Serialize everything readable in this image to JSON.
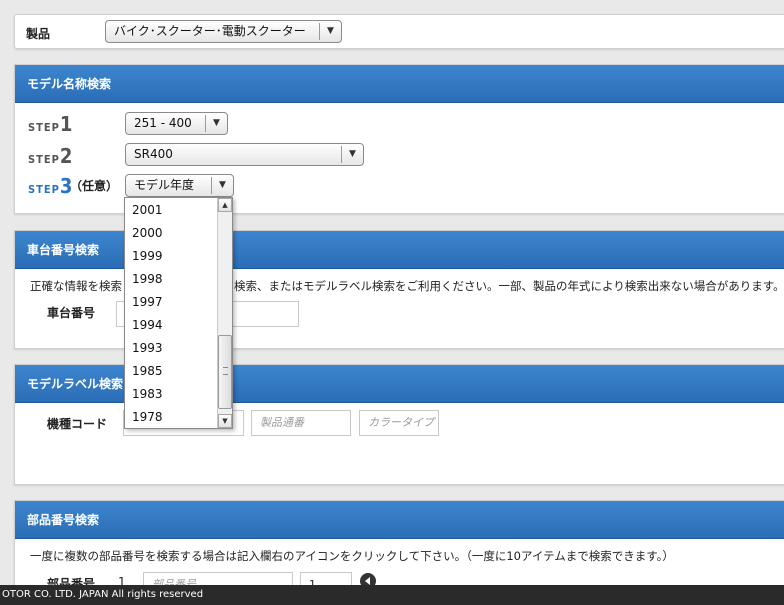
{
  "product": {
    "label": "製品",
    "selected": "バイク･スクーター･電動スクーター"
  },
  "model_search": {
    "title": "モデル名称検索",
    "step1": {
      "word": "STEP",
      "num": "1",
      "selected": "251 - 400"
    },
    "step2": {
      "word": "STEP",
      "num": "2",
      "selected": "SR400"
    },
    "step3": {
      "word": "STEP",
      "num": "3",
      "optional": "（任意）",
      "selected": "モデル年度"
    },
    "year_options": [
      "2001",
      "2000",
      "1999",
      "1998",
      "1997",
      "1994",
      "1993",
      "1985",
      "1983",
      "1978"
    ]
  },
  "frame_search": {
    "title": "車台番号検索",
    "note_left": "正確な情報を検索",
    "note_right": "検索、またはモデルラベル検索をご利用ください。一部、製品の年式により検索出来ない場合があります。",
    "field_label": "車台番号"
  },
  "label_search": {
    "title": "モデルラベル検索",
    "field_label": "機種コード",
    "placeholder_serial": "製品通番",
    "placeholder_color": "カラータイプ"
  },
  "part_search": {
    "title": "部品番号検索",
    "note": "一度に複数の部品番号を検索する場合は記入欄右のアイコンをクリックして下さい。（一度に10アイテムまで検索できます。）",
    "field_label": "部品番号",
    "row_index": "1",
    "placeholder_part": "部品番号",
    "qty_value": "1"
  },
  "footer": {
    "copyright": "OTOR CO. LTD. JAPAN All rights reserved"
  }
}
